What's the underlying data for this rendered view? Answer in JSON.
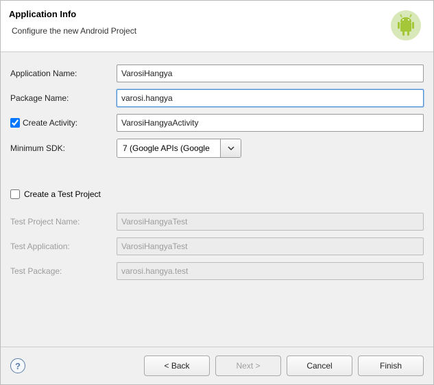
{
  "header": {
    "title": "Application Info",
    "subtitle": "Configure the new Android Project"
  },
  "form": {
    "appNameLabel": "Application Name:",
    "appNameValue": "VarosiHangya",
    "packageNameLabel": "Package Name:",
    "packageNameValue": "varosi.hangya",
    "createActivityLabel": "Create Activity:",
    "createActivityValue": "VarosiHangyaActivity",
    "minSdkLabel": "Minimum SDK:",
    "minSdkValue": "7 (Google APIs (Google",
    "createTestLabel": "Create a Test Project",
    "testProjectNameLabel": "Test Project Name:",
    "testProjectNameValue": "VarosiHangyaTest",
    "testApplicationLabel": "Test Application:",
    "testApplicationValue": "VarosiHangyaTest",
    "testPackageLabel": "Test Package:",
    "testPackageValue": "varosi.hangya.test"
  },
  "footer": {
    "back": "< Back",
    "next": "Next >",
    "cancel": "Cancel",
    "finish": "Finish",
    "helpGlyph": "?"
  },
  "icons": {
    "androidBg": "#a4c739"
  }
}
